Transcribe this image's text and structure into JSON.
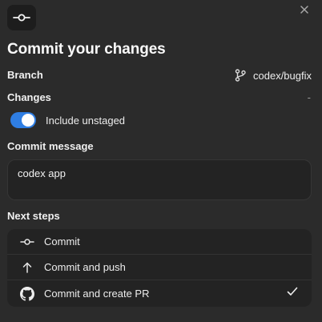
{
  "title": "Commit your changes",
  "branch": {
    "label": "Branch",
    "value": "codex/bugfix"
  },
  "changes": {
    "label": "Changes",
    "value": "-"
  },
  "include_unstaged": {
    "label": "Include unstaged",
    "enabled": true
  },
  "commit_message": {
    "label": "Commit message",
    "value": "codex app"
  },
  "next_steps": {
    "label": "Next steps",
    "items": [
      {
        "label": "Commit",
        "icon": "commit-icon",
        "selected": false
      },
      {
        "label": "Commit and push",
        "icon": "arrow-up-icon",
        "selected": false
      },
      {
        "label": "Commit and create PR",
        "icon": "github-icon",
        "selected": true
      }
    ]
  },
  "colors": {
    "accent": "#2f7ee3",
    "background": "#2b2b2b",
    "surface": "#232323"
  }
}
